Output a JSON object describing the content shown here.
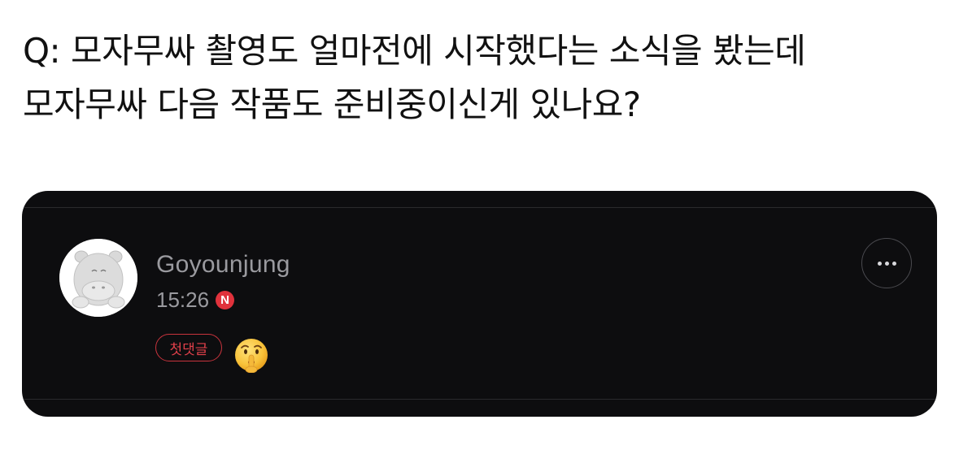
{
  "question": {
    "line1": "Q: 모자무싸 촬영도 얼마전에 시작했다는 소식을 봤는데",
    "line2": "모자무싸 다음 작품도 준비중이신게 있나요?"
  },
  "comment": {
    "username": "Goyounjung",
    "time": "15:26",
    "new_badge": "N",
    "first_comment_badge": "첫댓글",
    "emoji": "shushing-face-emoji"
  },
  "more_button_icon": "more-dots-icon",
  "colors": {
    "card_background": "#0d0d0f",
    "username": "#9a9a9f",
    "badge_red": "#e0323c"
  }
}
